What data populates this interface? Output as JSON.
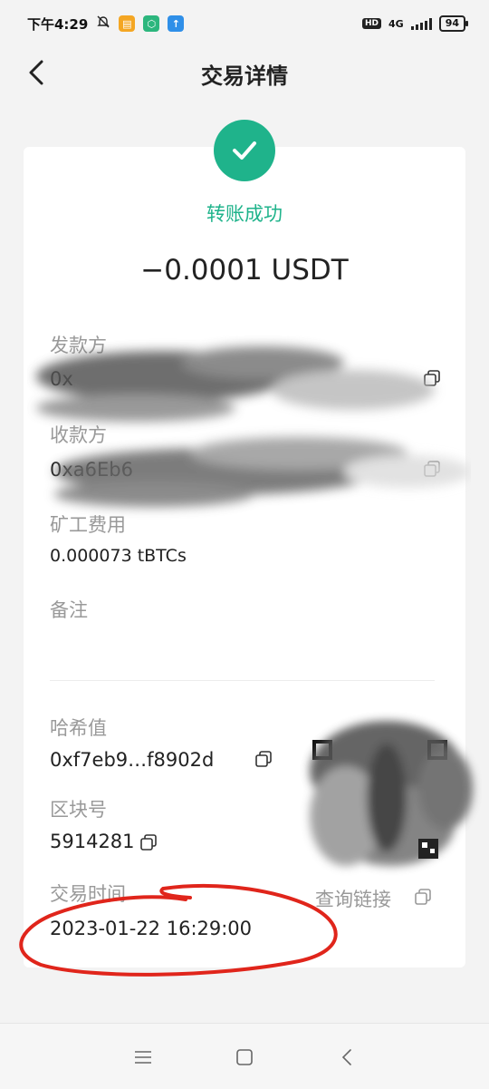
{
  "status_bar": {
    "time": "下午4:29",
    "network": "4G",
    "battery": "94",
    "hd": "HD"
  },
  "header": {
    "title": "交易详情"
  },
  "transaction": {
    "status": "转账成功",
    "amount": "−0.0001 USDT",
    "sender_label": "发款方",
    "sender_value": "0x",
    "receiver_label": "收款方",
    "receiver_value": "0xa6Eb6",
    "fee_label": "矿工费用",
    "fee_value": "0.000073 tBTCs",
    "memo_label": "备注",
    "hash_label": "哈希值",
    "hash_value": "0xf7eb9…f8902d",
    "block_label": "区块号",
    "block_value": "5914281",
    "time_label": "交易时间",
    "time_value": "2023-01-22 16:29:00",
    "query_link": "查询链接"
  },
  "colors": {
    "success": "#1fb38b",
    "annotation": "#e0251b"
  }
}
